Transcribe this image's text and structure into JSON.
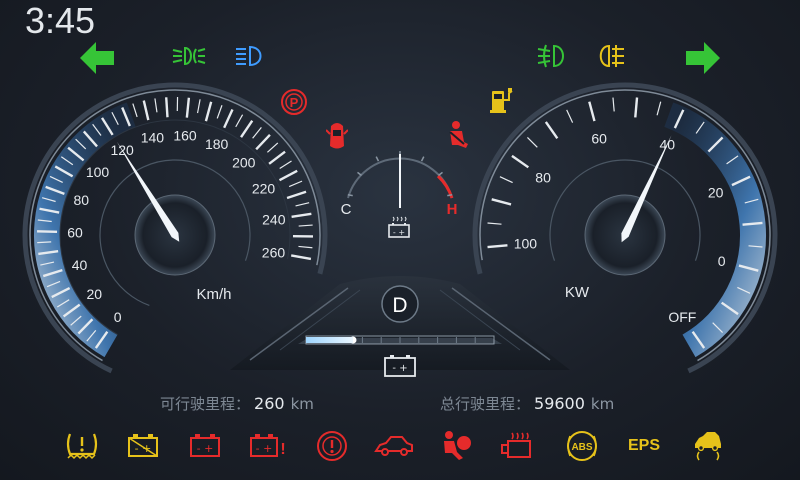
{
  "top_bar": {
    "time": "3:45",
    "left_turn_icon": "arrow-left-icon",
    "right_turn_icon": "arrow-right-icon",
    "indicators_left": [
      "front-fog-light-icon",
      "low-beam-icon"
    ],
    "indicators_right": [
      "position-light-icon",
      "rear-fog-light-icon"
    ]
  },
  "warnings_top": [
    "parking-brake-icon",
    "door-open-icon",
    "seatbelt-icon",
    "fuel-icon"
  ],
  "speedometer": {
    "ticks": [
      "0",
      "20",
      "40",
      "60",
      "80",
      "100",
      "120",
      "140",
      "160",
      "180",
      "200",
      "220",
      "240",
      "260"
    ],
    "unit": "Km/h",
    "value": 120,
    "max": 260
  },
  "power_meter": {
    "ticks": [
      "OFF",
      "0",
      "20",
      "40",
      "60",
      "80",
      "100"
    ],
    "unit": "KW",
    "value": 40
  },
  "temperature": {
    "cold_label": "C",
    "hot_label": "H",
    "level": 0.5
  },
  "center": {
    "gear": "D",
    "battery_level": 0.25
  },
  "range": {
    "label": "可行驶里程：",
    "value": "260",
    "unit": "km"
  },
  "odometer": {
    "label": "总行驶里程：",
    "value": "59600",
    "unit": "km"
  },
  "bottom_indicators": {
    "icons": [
      "tire-pressure-icon",
      "battery-fault-icon",
      "battery-icon",
      "battery-warning-icon",
      "brake-warning-icon",
      "car-lift-icon",
      "airbag-icon",
      "engine-heat-icon",
      "abs-icon"
    ],
    "eps_label": "EPS",
    "last_icon": "traction-control-icon"
  },
  "colors": {
    "green": "#2ecc40",
    "blue": "#3f9cff",
    "red": "#e52b2b",
    "yellow": "#e6c21a",
    "white": "#e6eaee"
  }
}
